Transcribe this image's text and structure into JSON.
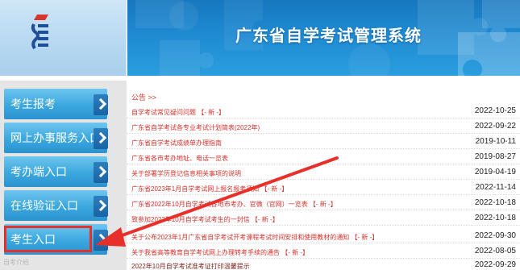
{
  "header": {
    "site_title": "广东省自学考试管理系统",
    "logo_icon": "exam-board-logo-icon"
  },
  "sidebar": {
    "items": [
      {
        "label": "考生报考"
      },
      {
        "label": "网上办事服务入口"
      },
      {
        "label": "考办端入口"
      },
      {
        "label": "在线验证入口"
      },
      {
        "label": "考生入口"
      }
    ],
    "footer_text": "自考介绍"
  },
  "notices": {
    "heading": "公告 >>",
    "rows": [
      {
        "title": "自学考试常见疑问问题 【- 新 -】",
        "date": "2022-10-25"
      },
      {
        "title": "广东省自学考试各专业考试计划简表(2022年)",
        "date": "2022-09-22"
      },
      {
        "title": "广东省自学考试成绩单办理指南",
        "date": "2019-10-11"
      },
      {
        "title": "广东省各市考办地址、电话一览表",
        "date": "2019-08-27"
      },
      {
        "title": "关于部署学历登记信息相关事项的说明",
        "date": "2019-04-19"
      },
      {
        "title": "广东省2023年1月自学考试网上报名报考须知 【- 新 -】",
        "date": "2022-11-14"
      },
      {
        "title": "广东省2022年10月自学考试各地市考办、官微（官网）一览表 【- 新 -】",
        "date": "2022-10-18"
      },
      {
        "title": "致参加2022年10月自学考试考生的一封信 【- 新 -】",
        "date": "2022-10-18"
      },
      {
        "title": "关于公布2023年1月广东省自学考试开考课程考试时间安排和使用教材的通知 【- 新 -】",
        "date": "2022-09-30"
      },
      {
        "title": "关于我省高等教育自学考试网上办理转考手续的通告 【- 新 -】",
        "date": "2022-08-05"
      },
      {
        "title": "2022年10月自学考试准考证打印温馨提示",
        "date": "2022-09-29"
      }
    ]
  },
  "colors": {
    "banner": "#1e8ad2",
    "nav_button": "#3aa7de",
    "notice_link": "#d4322c",
    "annotation": "#e8302a"
  }
}
